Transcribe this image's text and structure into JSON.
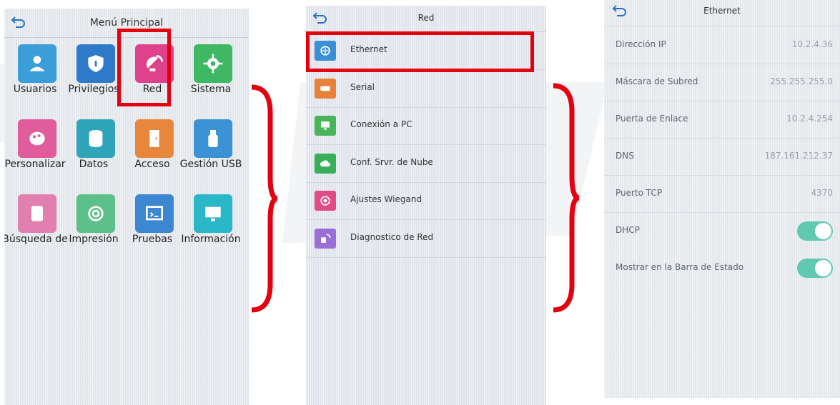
{
  "screen1": {
    "title": "Menú Principal",
    "items": [
      {
        "label": "Usuarios",
        "icon": "users-icon",
        "color": "#3c9ed8"
      },
      {
        "label": "Privilegios",
        "icon": "shield-icon",
        "color": "#2f79c9"
      },
      {
        "label": "Red",
        "icon": "network-dish-icon",
        "color": "#e0418b"
      },
      {
        "label": "Sistema",
        "icon": "gear-icon",
        "color": "#3fb864"
      },
      {
        "label": "Personalizar",
        "icon": "palette-icon",
        "color": "#e05c9b"
      },
      {
        "label": "Datos",
        "icon": "database-icon",
        "color": "#2ea5b9"
      },
      {
        "label": "Acceso",
        "icon": "door-icon",
        "color": "#e8863b"
      },
      {
        "label": "Gestión USB",
        "icon": "usb-icon",
        "color": "#3b93d6"
      },
      {
        "label": "Búsqueda de",
        "icon": "search-record-icon",
        "color": "#e07fb0"
      },
      {
        "label": "Impresión",
        "icon": "fingerprint-icon",
        "color": "#5cc08b"
      },
      {
        "label": "Pruebas",
        "icon": "autotest-icon",
        "color": "#3d86d1"
      },
      {
        "label": "Información",
        "icon": "monitor-icon",
        "color": "#2ab7c9"
      }
    ]
  },
  "screen2": {
    "title": "Red",
    "items": [
      {
        "label": "Ethernet",
        "icon": "globe-icon",
        "color": "#3a8fd9"
      },
      {
        "label": "Serial",
        "icon": "serial-port-icon",
        "color": "#e8813a"
      },
      {
        "label": "Conexión a PC",
        "icon": "pc-connection-icon",
        "color": "#49b55a"
      },
      {
        "label": "Conf. Srvr. de Nube",
        "icon": "cloud-icon",
        "color": "#3aae5b"
      },
      {
        "label": "Ajustes Wiegand",
        "icon": "wiegand-icon",
        "color": "#e04c86"
      },
      {
        "label": "Diagnostico de Red",
        "icon": "network-diagnostic-icon",
        "color": "#9a6fd8"
      }
    ]
  },
  "screen3": {
    "title": "Ethernet",
    "fields": [
      {
        "key": "Dirección IP",
        "value": "10.2.4.36"
      },
      {
        "key": "Máscara de Subred",
        "value": "255.255.255.0"
      },
      {
        "key": "Puerta de Enlace",
        "value": "10.2.4.254"
      },
      {
        "key": "DNS",
        "value": "187.161.212.37"
      },
      {
        "key": "Puerto TCP",
        "value": "4370"
      }
    ],
    "toggles": [
      {
        "key": "DHCP",
        "on": true
      },
      {
        "key": "Mostrar en la Barra de Estado",
        "on": true
      }
    ]
  },
  "colors": {
    "highlight": "#e3000f",
    "toggle_on": "#5fc9b2"
  }
}
